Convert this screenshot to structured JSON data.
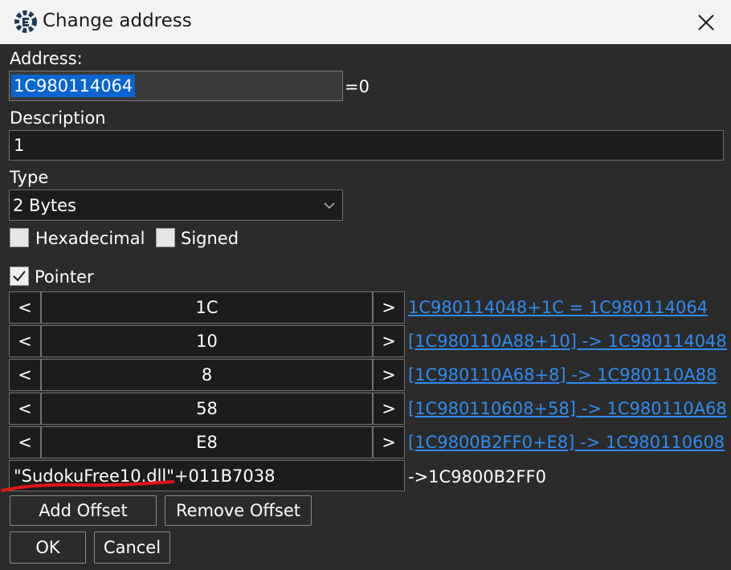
{
  "window": {
    "title": "Change address",
    "icon": "cheat-engine-gear-icon",
    "close_icon": "close-icon"
  },
  "address": {
    "label": "Address:",
    "value": "1C980114064",
    "result": "=0"
  },
  "description": {
    "label": "Description",
    "value": "1"
  },
  "type": {
    "label": "Type",
    "selected": "2 Bytes",
    "hexadecimal_label": "Hexadecimal",
    "hexadecimal_checked": false,
    "signed_label": "Signed",
    "signed_checked": false
  },
  "pointer": {
    "label": "Pointer",
    "checked": true,
    "dec_label": "<",
    "inc_label": ">",
    "offsets": [
      {
        "value": "1C",
        "resolved": "1C980114048+1C = 1C980114064"
      },
      {
        "value": "10",
        "resolved": "[1C980110A88+10] -> 1C980114048"
      },
      {
        "value": "8",
        "resolved": "[1C980110A68+8] -> 1C980110A88"
      },
      {
        "value": "58",
        "resolved": "[1C980110608+58] -> 1C980110A68"
      },
      {
        "value": "E8",
        "resolved": "[1C9800B2FF0+E8] -> 1C980110608"
      }
    ],
    "base_address": "\"SudokuFree10.dll\"+011B7038",
    "base_result": "->1C9800B2FF0"
  },
  "buttons": {
    "add_offset": "Add Offset",
    "remove_offset": "Remove Offset",
    "ok": "OK",
    "cancel": "Cancel"
  },
  "colors": {
    "background": "#2b2b2b",
    "titlebar": "#f3f3f3",
    "field": "#1c1c1c",
    "link": "#2f8cf0",
    "selection": "#0a64d2",
    "annotation": "#e0141e"
  }
}
